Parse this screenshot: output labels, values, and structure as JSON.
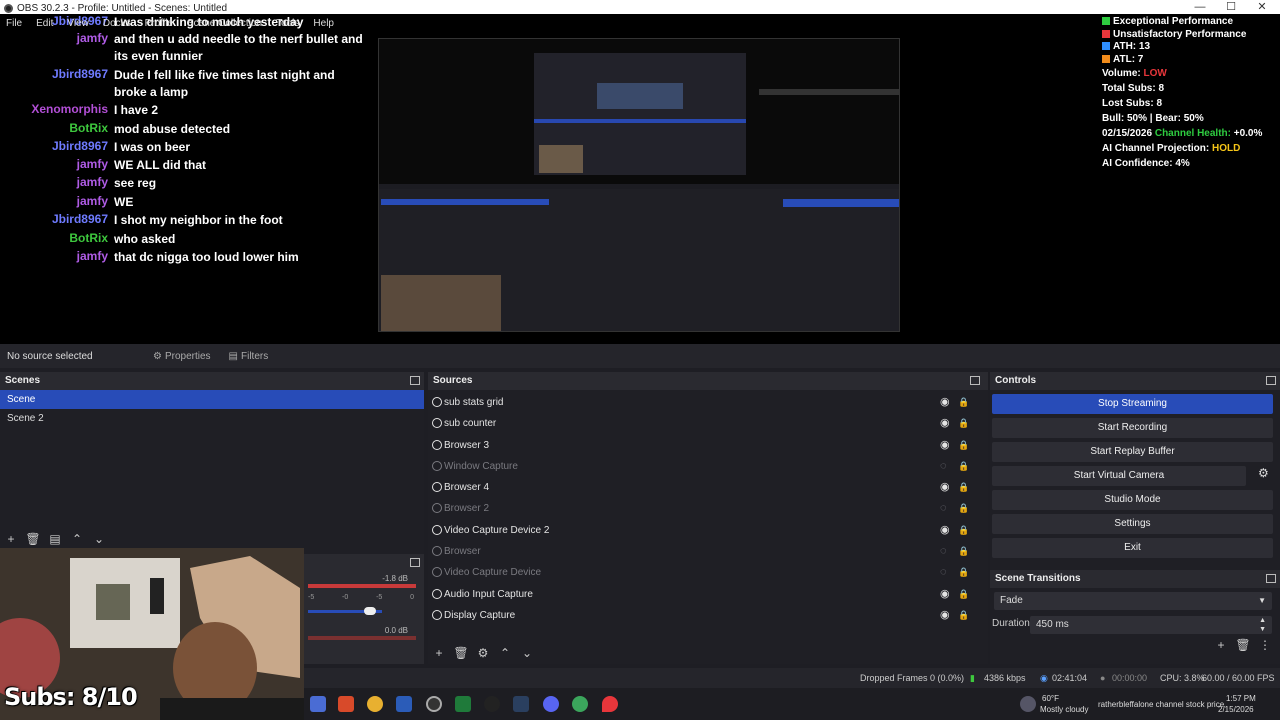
{
  "window": {
    "title": "OBS 30.2.3 - Profile: Untitled - Scenes: Untitled",
    "min": "—",
    "max": "☐",
    "close": "✕"
  },
  "menu": [
    "File",
    "Edit",
    "View",
    "Docks",
    "Profile",
    "Scene Collection",
    "Tools",
    "Help"
  ],
  "chat": [
    {
      "user": "Jbird8967",
      "msg": "I was drinking to much yesterday",
      "color": "#6f7bff"
    },
    {
      "user": "jamfy",
      "msg": "and then u add needle to the nerf bullet and its even funnier",
      "color": "#b05ce6"
    },
    {
      "user": "Jbird8967",
      "msg": "Dude I fell like five times last night and broke a lamp",
      "color": "#6f7bff"
    },
    {
      "user": "Xenomorphis",
      "msg": "I have 2",
      "color": "#b24fd6"
    },
    {
      "user": "BotRix",
      "msg": "mod abuse detected",
      "color": "#3ec83e"
    },
    {
      "user": "Jbird8967",
      "msg": "I was on beer",
      "color": "#6f7bff"
    },
    {
      "user": "jamfy",
      "msg": "WE ALL did that",
      "color": "#b05ce6"
    },
    {
      "user": "jamfy",
      "msg": "see reg",
      "color": "#b05ce6"
    },
    {
      "user": "jamfy",
      "msg": "WE",
      "color": "#b05ce6"
    },
    {
      "user": "Jbird8967",
      "msg": "I shot my neighbor in the foot",
      "color": "#6f7bff"
    },
    {
      "user": "BotRix",
      "msg": "who asked",
      "color": "#3ec83e"
    },
    {
      "user": "jamfy",
      "msg": "that dc nigga too loud lower him",
      "color": "#b05ce6"
    }
  ],
  "stats": {
    "legend": [
      {
        "label": "Exceptional Performance",
        "color": "#2ecc40"
      },
      {
        "label": "Unsatisfactory Performance",
        "color": "#e8363b"
      },
      {
        "label": "ATH: 13",
        "color": "#2f8fff"
      },
      {
        "label": "ATL: 7",
        "color": "#f28c1b"
      }
    ],
    "volume_label": "Volume:",
    "volume_value": "LOW",
    "total_subs": "Total Subs: 8",
    "lost_subs": "Lost Subs: 8",
    "bull_bear": "Bull: 50% | Bear: 50%",
    "date": "02/15/2026",
    "health_label": "Channel Health:",
    "health_value": "+0.0%",
    "projection_label": "AI Channel Projection:",
    "projection_value": "HOLD",
    "confidence": "AI Confidence: 4%",
    "colors": {
      "health": "#2ecc40",
      "hold": "#f5c518",
      "low": "#e8363b"
    }
  },
  "props": {
    "no_source": "No source selected",
    "properties": "Properties",
    "filters": "Filters"
  },
  "scenes": {
    "title": "Scenes",
    "items": [
      "Scene",
      "Scene 2"
    ]
  },
  "sources": {
    "title": "Sources",
    "items": [
      {
        "label": "sub stats grid",
        "dim": false
      },
      {
        "label": "sub counter",
        "dim": false
      },
      {
        "label": "Browser 3",
        "dim": false
      },
      {
        "label": "Window Capture",
        "dim": true
      },
      {
        "label": "Browser 4",
        "dim": false
      },
      {
        "label": "Browser 2",
        "dim": true
      },
      {
        "label": "Video Capture Device 2",
        "dim": false
      },
      {
        "label": "Browser",
        "dim": true
      },
      {
        "label": "Video Capture Device",
        "dim": true
      },
      {
        "label": "Audio Input Capture",
        "dim": false
      },
      {
        "label": "Display Capture",
        "dim": false
      }
    ]
  },
  "controls": {
    "title": "Controls",
    "buttons": [
      "Stop Streaming",
      "Start Recording",
      "Start Replay Buffer",
      "Start Virtual Camera",
      "Studio Mode",
      "Settings",
      "Exit"
    ]
  },
  "transitions": {
    "title": "Scene Transitions",
    "type": "Fade",
    "duration_label": "Duration",
    "duration_value": "450 ms"
  },
  "mixer": {
    "db1": "-1.8 dB",
    "db2": "0.0 dB"
  },
  "overlay": {
    "subs": "Subs: 8/10"
  },
  "status": {
    "dropped": "Dropped Frames 0 (0.0%)",
    "kbps": "4386 kbps",
    "stream_time": "02:41:04",
    "rec_time": "00:00:00",
    "cpu": "CPU: 3.8%",
    "fps": "60.00 / 60.00 FPS"
  },
  "taskbar": {
    "temp": "60°F",
    "weather": "Mostly cloudy",
    "ticker": "ratherbleffalone channel stock price",
    "time": "1:57 PM",
    "date": "2/15/2026"
  }
}
